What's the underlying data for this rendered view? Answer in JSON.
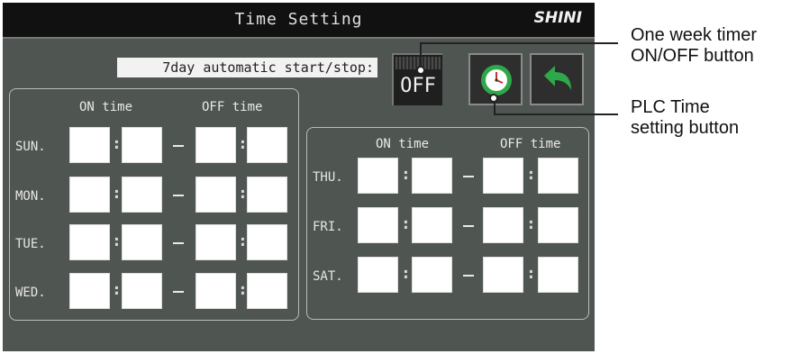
{
  "header": {
    "title": "Time Setting",
    "logo": "SHINI"
  },
  "auto_label": "7day automatic start/stop:",
  "timer_button": {
    "label": "OFF"
  },
  "icons": {
    "clock": "clock-icon",
    "back": "back-arrow-icon"
  },
  "left_group": {
    "on_header": "ON time",
    "off_header": "OFF time",
    "days": [
      "SUN.",
      "MON.",
      "TUE.",
      "WED."
    ]
  },
  "right_group": {
    "on_header": "ON time",
    "off_header": "OFF time",
    "days": [
      "THU.",
      "FRI.",
      "SAT."
    ]
  },
  "colon_char": ":",
  "annotations": {
    "timer": {
      "line1": "One week timer",
      "line2": "ON/OFF button"
    },
    "plc": {
      "line1": "PLC Time",
      "line2": "setting button"
    }
  },
  "colors": {
    "panel": "#4f5651",
    "titlebar": "#111111",
    "accent_green": "#2ea84a"
  }
}
